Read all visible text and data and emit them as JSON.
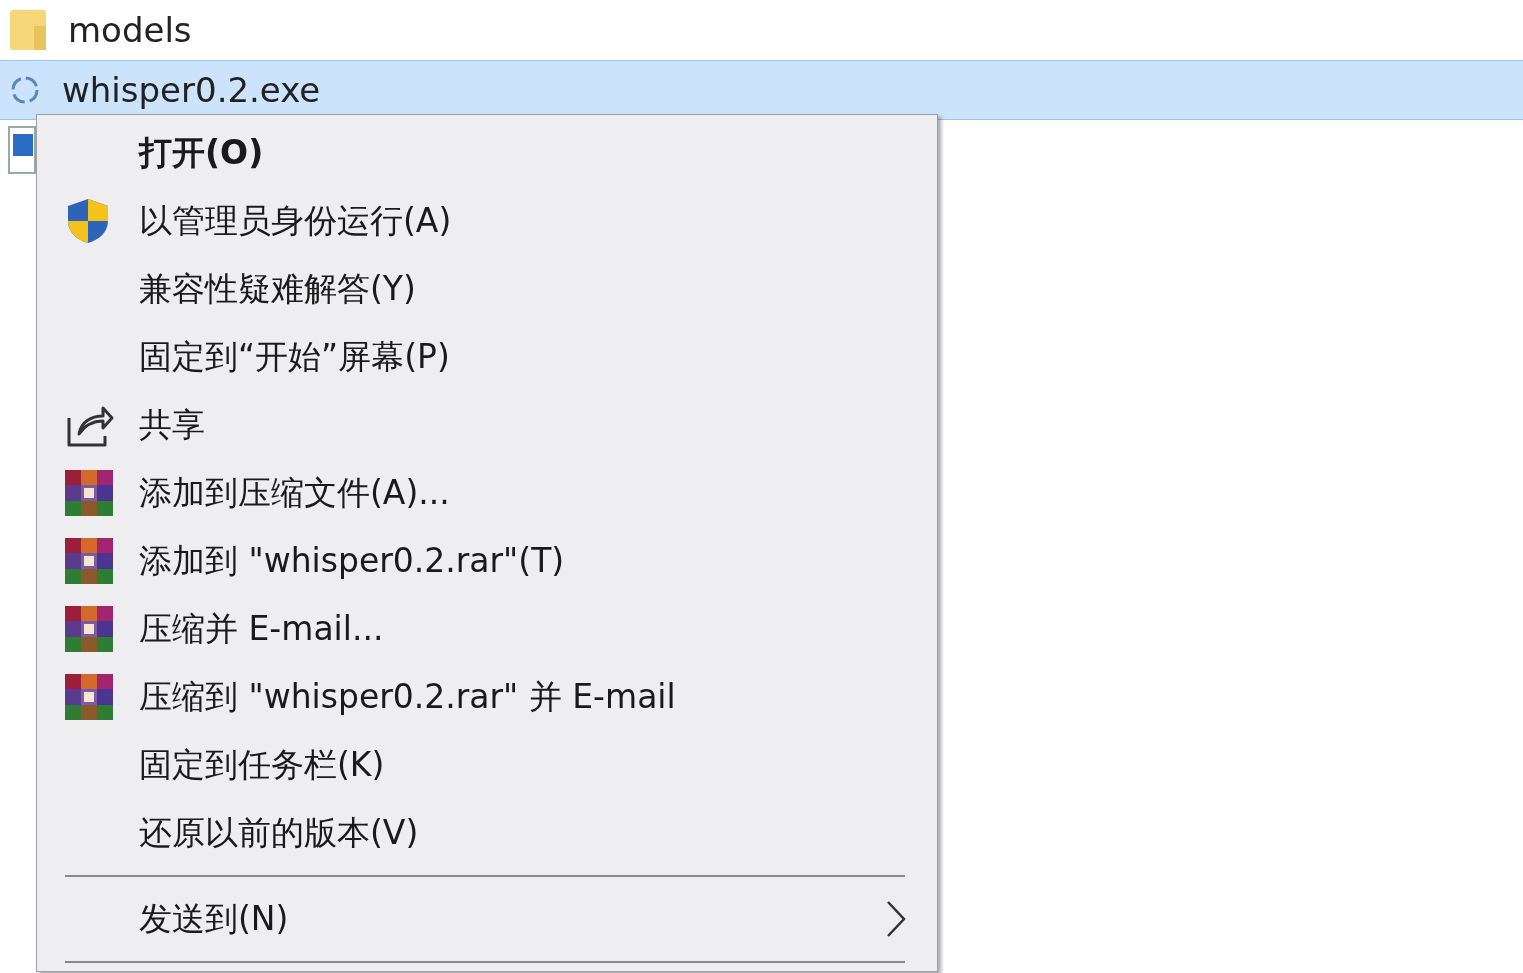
{
  "files": [
    {
      "name": "models",
      "kind": "folder",
      "selected": false
    },
    {
      "name": "whisper0.2.exe",
      "kind": "program",
      "selected": true
    },
    {
      "kind": "image",
      "selected": false
    }
  ],
  "context_menu": {
    "items": [
      {
        "kind": "plain",
        "label": "打开(O)",
        "default": true,
        "submenu": false
      },
      {
        "kind": "shield",
        "label": "以管理员身份运行(A)",
        "default": false,
        "submenu": false
      },
      {
        "kind": "plain",
        "label": "兼容性疑难解答(Y)",
        "default": false,
        "submenu": false
      },
      {
        "kind": "plain",
        "label": "固定到“开始”屏幕(P)",
        "default": false,
        "submenu": false
      },
      {
        "kind": "share",
        "label": "共享",
        "default": false,
        "submenu": false
      },
      {
        "kind": "archive",
        "label": "添加到压缩文件(A)...",
        "default": false,
        "submenu": false
      },
      {
        "kind": "archive",
        "label": "添加到 \"whisper0.2.rar\"(T)",
        "default": false,
        "submenu": false
      },
      {
        "kind": "archive",
        "label": "压缩并 E-mail...",
        "default": false,
        "submenu": false
      },
      {
        "kind": "archive",
        "label": "压缩到 \"whisper0.2.rar\" 并 E-mail",
        "default": false,
        "submenu": false
      },
      {
        "kind": "plain",
        "label": "固定到任务栏(K)",
        "default": false,
        "submenu": false
      },
      {
        "kind": "plain",
        "label": "还原以前的版本(V)",
        "default": false,
        "submenu": false
      },
      {
        "kind": "separator"
      },
      {
        "kind": "plain",
        "label": "发送到(N)",
        "default": false,
        "submenu": true
      },
      {
        "kind": "separator"
      }
    ]
  }
}
